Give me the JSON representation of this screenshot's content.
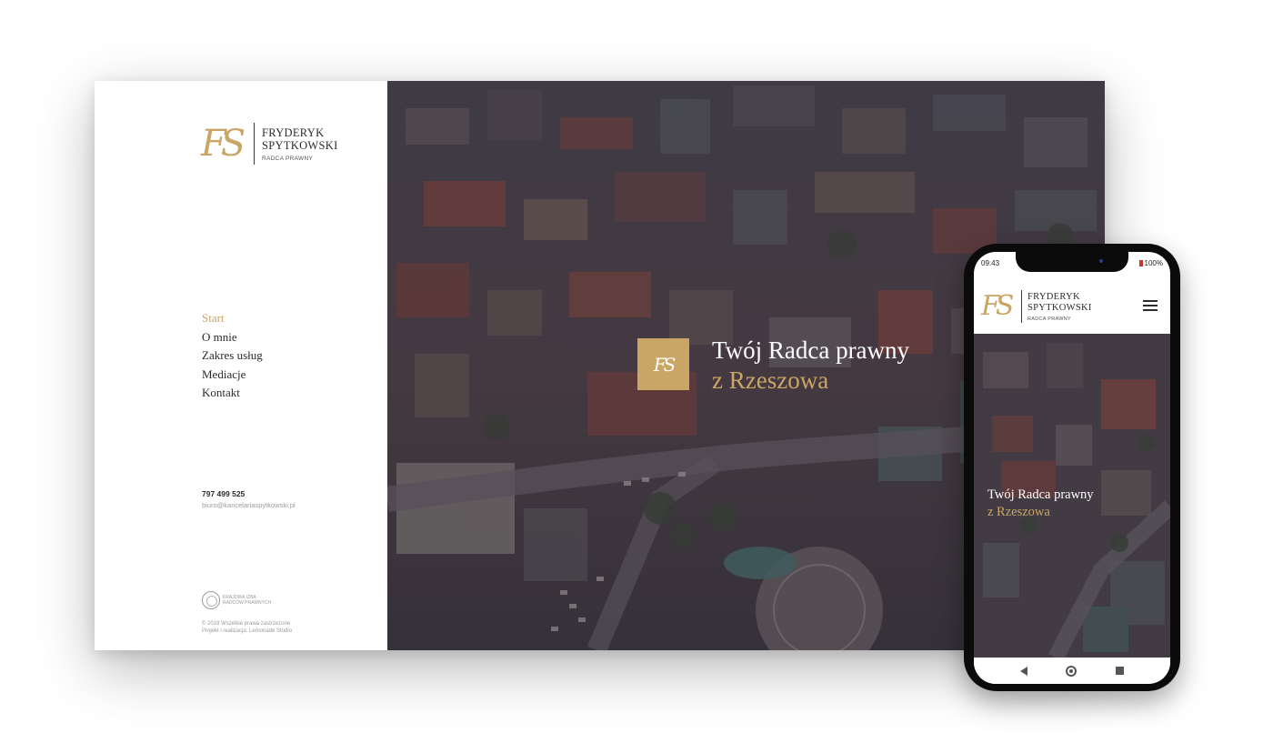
{
  "brand": {
    "monogram": "FS",
    "name_line1": "FRYDERYK",
    "name_line2": "SPYTKOWSKI",
    "subtitle": "RADCA PRAWNY",
    "accent_color": "#c9a666"
  },
  "nav": {
    "items": [
      {
        "label": "Start",
        "active": true
      },
      {
        "label": "O mnie",
        "active": false
      },
      {
        "label": "Zakres usług",
        "active": false
      },
      {
        "label": "Mediacje",
        "active": false
      },
      {
        "label": "Kontakt",
        "active": false
      }
    ]
  },
  "contact": {
    "phone": "797 499 525",
    "email": "biuro@kancelariaspytkowski.pl"
  },
  "kirp": {
    "line1": "KRAJOWA IZBA",
    "line2": "RADCÓW PRAWNYCH"
  },
  "footer": {
    "copyright": "© 2018 Wszelkie prawa zastrzeżone",
    "credits": "Projekt i realizacja: Lemonade Studio"
  },
  "hero": {
    "line1": "Twój Radca prawny",
    "line2": "z Rzeszowa"
  },
  "mobile": {
    "status_time": "09:43",
    "battery": "100%",
    "menu_icon": "hamburger-icon"
  }
}
